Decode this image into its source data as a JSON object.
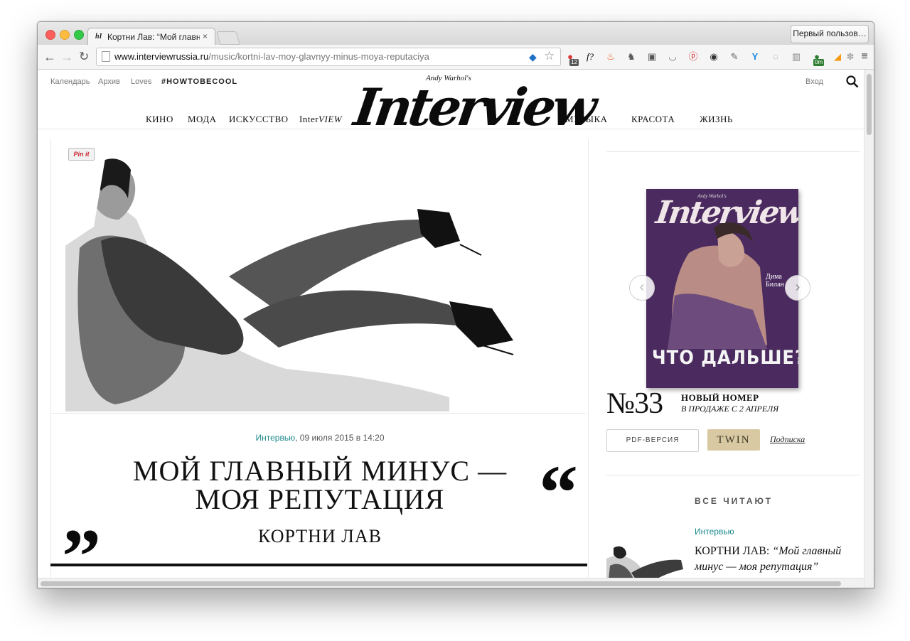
{
  "browser": {
    "tab_title": "Кортни Лав: “Мой главны",
    "tab_close": "×",
    "profile_button": "Первый пользов…",
    "url_host": "www.interviewrussia.ru",
    "url_path": "/music/kortni-lav-moy-glavnyy-minus-moya-reputaciya",
    "extension_badges": [
      "12",
      "0m"
    ]
  },
  "header": {
    "utility_links": [
      "Календарь",
      "Архив",
      "Loves",
      "#HOWTOBECOOL"
    ],
    "login": "Вход",
    "nav_left": [
      "КИНО",
      "МОДА",
      "ИСКУССТВО"
    ],
    "nav_interview": {
      "prefix": "Inter",
      "suffix": "VIEW"
    },
    "nav_right": [
      "МУЗЫКА",
      "КРАСОТА",
      "ЖИЗНЬ"
    ],
    "logo": {
      "signature": "Andy Warhol's",
      "wordmark": "Interview"
    }
  },
  "article": {
    "pinit": "Pin it",
    "rubric": "Интервью",
    "date": "09 июля 2015 в 14:20",
    "headline_line1": "МОЙ ГЛАВНЫЙ МИНУС —",
    "headline_line2": "МОЯ РЕПУТАЦИЯ",
    "subhead": "КОРТНИ ЛАВ",
    "quote_open": "“",
    "quote_close": "”"
  },
  "sidebar": {
    "cover": {
      "signature": "Andy Warhol's",
      "logo": "Interview",
      "name": "Дима Билан",
      "headline": "ЧТО ДАЛЬШЕ?"
    },
    "issue": {
      "number": "№33",
      "new_label": "НОВЫЙ НОМЕР",
      "date": "В ПРОДАЖЕ С 2 АПРЕЛЯ"
    },
    "carousel": {
      "prev": "‹",
      "next": "›"
    },
    "pdf_button": "PDF-ВЕРСИЯ",
    "twin_button": "TWIN",
    "subscribe": "Подписка",
    "popular": {
      "title": "ВСЕ ЧИТАЮТ",
      "rubric": "Интервью",
      "item_name": "КОРТНИ ЛАВ: ",
      "item_quote": "“Мой главный минус — моя репутация”"
    }
  }
}
